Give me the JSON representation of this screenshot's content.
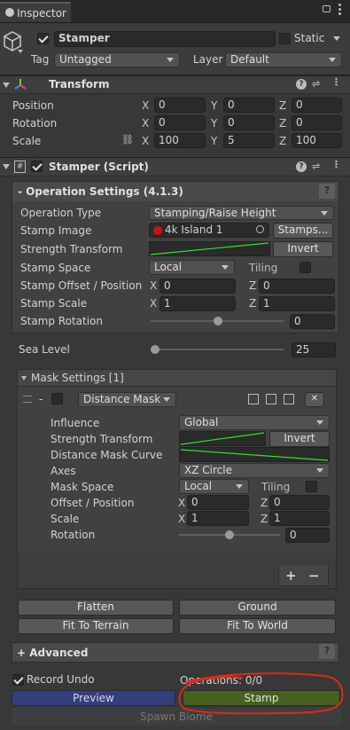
{
  "tab": {
    "label": "Inspector"
  },
  "object": {
    "name": "Stamper",
    "static_label": "Static",
    "tag_label": "Tag",
    "tag_value": "Untagged",
    "layer_label": "Layer",
    "layer_value": "Default"
  },
  "transform": {
    "title": "Transform",
    "rows": [
      {
        "label": "Position",
        "x": "0",
        "y": "0",
        "z": "0"
      },
      {
        "label": "Rotation",
        "x": "0",
        "y": "0",
        "z": "0"
      },
      {
        "label": "Scale",
        "x": "100",
        "y": "5",
        "z": "100"
      }
    ]
  },
  "axis": {
    "x": "X",
    "y": "Y",
    "z": "Z"
  },
  "script": {
    "title": "Stamper (Script)"
  },
  "op": {
    "header": "- Operation Settings   (4.1.3)",
    "help": "?",
    "operation_type_label": "Operation Type",
    "operation_type_value": "Stamping/Raise Height",
    "stamp_image_label": "Stamp Image",
    "stamp_image_value": "4k Island 1",
    "stamps_button": "Stamps...",
    "strength_label": "Strength Transform",
    "invert_label": "Invert",
    "stamp_space_label": "Stamp Space",
    "stamp_space_value": "Local",
    "tiling_label": "Tiling",
    "offset_label": "Stamp Offset / Position",
    "offset_x": "0",
    "offset_z": "0",
    "scale_label": "Stamp Scale",
    "scale_x": "1",
    "scale_z": "1",
    "rotation_label": "Stamp Rotation",
    "rotation_value": "0",
    "sea_level_label": "Sea Level",
    "sea_level_value": "25"
  },
  "mask": {
    "header": "Mask Settings [1]",
    "minus": "-",
    "type_value": "Distance Mask",
    "close": "✕",
    "influence_label": "Influence",
    "influence_value": "Global",
    "strength_label": "Strength Transform",
    "invert_label": "Invert",
    "curve_label": "Distance Mask Curve",
    "axes_label": "Axes",
    "axes_value": "XZ Circle",
    "space_label": "Mask Space",
    "space_value": "Local",
    "tiling_label": "Tiling",
    "offset_label": "Offset / Position",
    "offset_x": "0",
    "offset_z": "0",
    "scale_label": "Scale",
    "scale_x": "1",
    "scale_z": "1",
    "rotation_label": "Rotation",
    "rotation_value": "0",
    "plus": "+",
    "minus_btn": "−"
  },
  "buttons": {
    "flatten": "Flatten",
    "ground": "Ground",
    "fit_terrain": "Fit To Terrain",
    "fit_world": "Fit To World"
  },
  "advanced": {
    "label": "+ Advanced",
    "help": "?"
  },
  "footer": {
    "record_undo": "Record Undo",
    "operations": "Operations: 0/0",
    "preview": "Preview",
    "stamp": "Stamp",
    "spawn_biome": "Spawn Biome"
  }
}
